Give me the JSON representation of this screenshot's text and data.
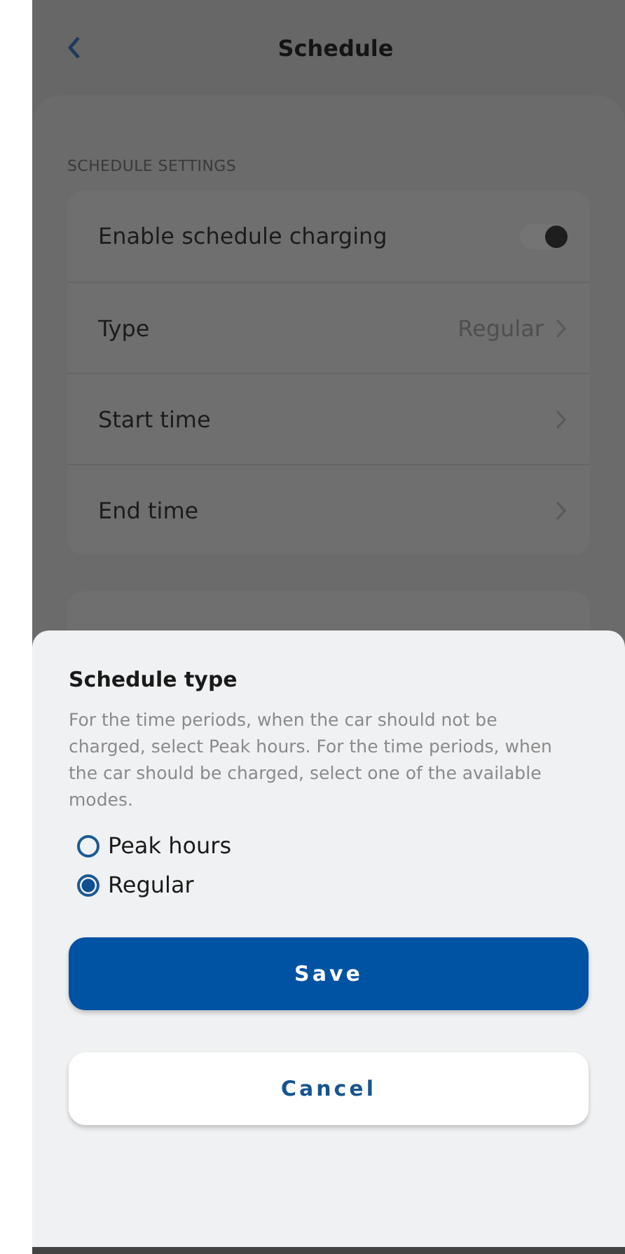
{
  "header": {
    "title": "Schedule"
  },
  "section": {
    "label": "SCHEDULE SETTINGS"
  },
  "settings": [
    {
      "kind": "toggle",
      "label": "Enable schedule charging",
      "on": true
    },
    {
      "kind": "link",
      "label": "Type",
      "value": "Regular"
    },
    {
      "kind": "link",
      "label": "Start time"
    },
    {
      "kind": "link",
      "label": "End time"
    }
  ],
  "sheet": {
    "title": "Schedule type",
    "description": "For the time periods, when the car should not be charged, select Peak hours. For the time periods, when the car should be charged, select one of the available modes.",
    "options": [
      {
        "label": "Peak hours",
        "selected": false
      },
      {
        "label": "Regular",
        "selected": true
      }
    ],
    "buttons": [
      {
        "kind": "primary",
        "label": "Save"
      },
      {
        "kind": "secondary",
        "label": "Cancel"
      }
    ]
  }
}
